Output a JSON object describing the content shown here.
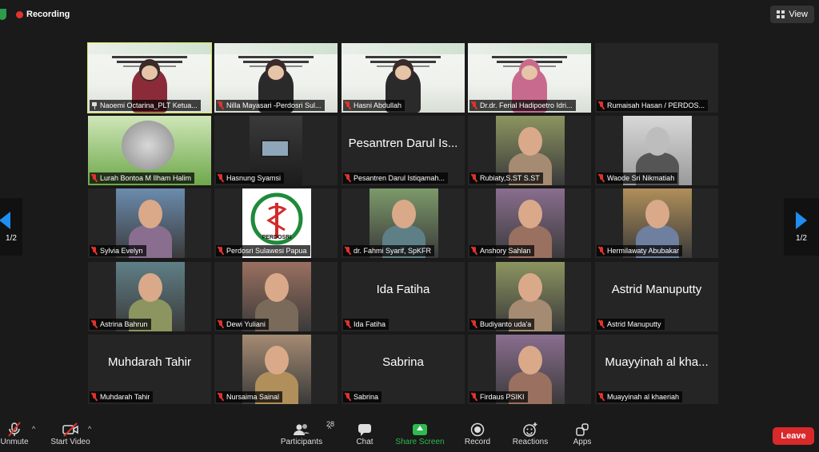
{
  "top": {
    "recording_label": "Recording",
    "view_label": "View"
  },
  "pager": {
    "left_label": "1/2",
    "right_label": "1/2"
  },
  "tiles": [
    {
      "name": "Naoemi Octarina_PLT Ketua...",
      "kind": "slide",
      "pin": true
    },
    {
      "name": "Nilla Mayasari -Perdosri Sul...",
      "kind": "slide"
    },
    {
      "name": "Hasni Abdullah",
      "kind": "slide"
    },
    {
      "name": "Dr.dr. Ferial Hadipoetro Idri...",
      "kind": "slide"
    },
    {
      "name": "Rumaisah Hasan / PERDOS...",
      "kind": "dark"
    },
    {
      "name": "Lurah Bontoa M Ilham Halim",
      "kind": "rice"
    },
    {
      "name": "Hasnung Syamsi",
      "kind": "dark"
    },
    {
      "name": "Pesantren Darul Istiqamah...",
      "kind": "text",
      "big": "Pesantren Darul Is..."
    },
    {
      "name": "Rubiaty,S.ST S.ST",
      "kind": "person"
    },
    {
      "name": "Waode Sri Nikmatiah",
      "kind": "bw"
    },
    {
      "name": "Sylvia Evelyn",
      "kind": "person"
    },
    {
      "name": "Perdosri Sulawesi Papua",
      "kind": "logo",
      "logo_text": "PERDOSRI"
    },
    {
      "name": "dr. Fahmi Syarif, SpKFR",
      "kind": "person"
    },
    {
      "name": "Anshory Sahlan",
      "kind": "person"
    },
    {
      "name": "Hermilawaty Abubakar",
      "kind": "person"
    },
    {
      "name": "Astrina Bahrun",
      "kind": "person"
    },
    {
      "name": "Dewi Yuliani",
      "kind": "person"
    },
    {
      "name": "Ida Fatiha",
      "kind": "text",
      "big": "Ida Fatiha"
    },
    {
      "name": "Budiyanto uda'a",
      "kind": "person"
    },
    {
      "name": "Astrid Manuputty",
      "kind": "text",
      "big": "Astrid Manuputty"
    },
    {
      "name": "Muhdarah Tahir",
      "kind": "text",
      "big": "Muhdarah Tahir"
    },
    {
      "name": "Nursaima Sainal",
      "kind": "person"
    },
    {
      "name": "Sabrina",
      "kind": "text",
      "big": "Sabrina"
    },
    {
      "name": "Firdaus PSIKI",
      "kind": "person"
    },
    {
      "name": "Muayyinah al khaeriah",
      "kind": "text",
      "big": "Muayyinah al kha..."
    }
  ],
  "toolbar": {
    "unmute": "Unmute",
    "start_video": "Start Video",
    "participants": "Participants",
    "participants_count": "28",
    "chat": "Chat",
    "share_screen": "Share Screen",
    "record": "Record",
    "reactions": "Reactions",
    "apps": "Apps",
    "leave": "Leave"
  },
  "colors": {
    "accent": "#1e8ef0",
    "leave": "#d9292a",
    "share": "#2dba4e",
    "muted": "#e0332d",
    "active_border": "#d7e85a"
  }
}
